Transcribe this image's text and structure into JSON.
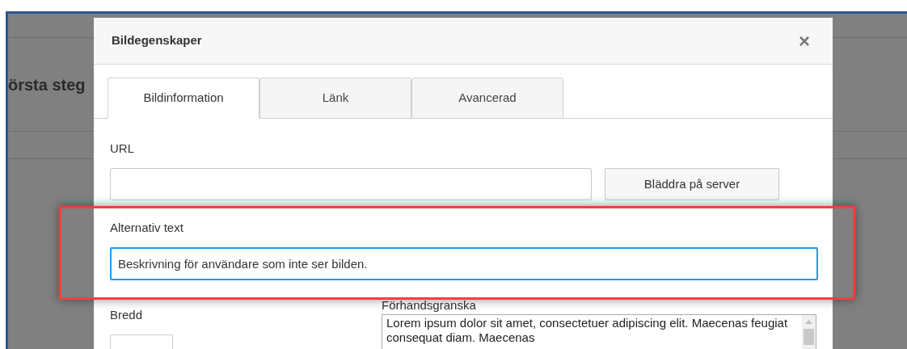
{
  "background": {
    "heading": "örsta steg"
  },
  "dialog": {
    "title": "Bildegenskaper",
    "close": "×",
    "tabs": [
      {
        "label": "Bildinformation",
        "selected": true
      },
      {
        "label": "Länk",
        "selected": false
      },
      {
        "label": "Avancerad",
        "selected": false
      }
    ],
    "url_field": {
      "label": "URL"
    },
    "browse_button": "Bläddra på server",
    "alt_text": {
      "label": "Alternativ text",
      "value": "Beskrivning för användare som inte ser bilden.",
      "focused": true,
      "highlighted": true
    },
    "width_field": {
      "label": "Bredd"
    },
    "preview": {
      "label": "Förhandsgranska",
      "text": "Lorem ipsum dolor sit amet, consectetuer adipiscing elit. Maecenas feugiat consequat diam. Maecenas"
    }
  }
}
